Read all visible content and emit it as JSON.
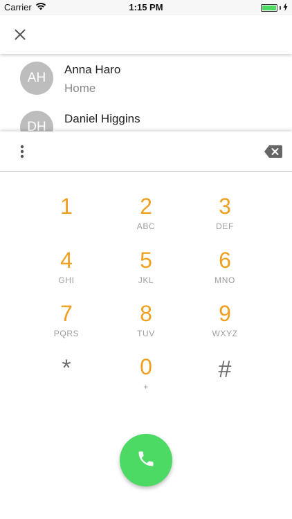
{
  "status_bar": {
    "carrier": "Carrier",
    "time": "1:15 PM",
    "battery_level": 1.0,
    "battery_color": "#4cd964"
  },
  "app_bar": {
    "close_icon": "close-icon"
  },
  "contacts": [
    {
      "initials": "AH",
      "name": "Anna Haro",
      "label": "Home"
    },
    {
      "initials": "DH",
      "name": "Daniel Higgins",
      "label": ""
    }
  ],
  "dialpad": {
    "number_value": "",
    "more_icon": "more-vertical-icon",
    "backspace_icon": "backspace-icon",
    "keys": [
      {
        "digit": "1",
        "letters": ""
      },
      {
        "digit": "2",
        "letters": "ABC"
      },
      {
        "digit": "3",
        "letters": "DEF"
      },
      {
        "digit": "4",
        "letters": "GHI"
      },
      {
        "digit": "5",
        "letters": "JKL"
      },
      {
        "digit": "6",
        "letters": "MNO"
      },
      {
        "digit": "7",
        "letters": "PQRS"
      },
      {
        "digit": "8",
        "letters": "TUV"
      },
      {
        "digit": "9",
        "letters": "WXYZ"
      },
      {
        "digit": "*",
        "letters": ""
      },
      {
        "digit": "0",
        "letters": "+"
      },
      {
        "digit": "#",
        "letters": ""
      }
    ],
    "digit_color": "#f0a020",
    "call_icon": "phone-icon",
    "call_color": "#4cd964"
  }
}
